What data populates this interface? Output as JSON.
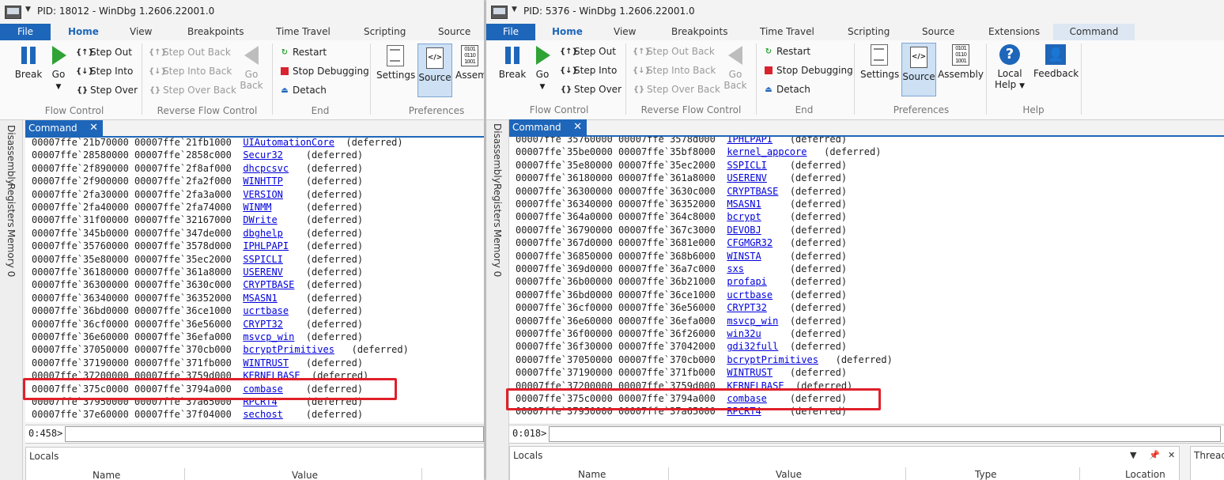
{
  "tabs": {
    "file": "File",
    "home": "Home",
    "view": "View",
    "breakpoints": "Breakpoints",
    "time_travel": "Time Travel",
    "scripting": "Scripting",
    "source": "Source",
    "extensions": "Extensions",
    "command": "Command"
  },
  "ribbon": {
    "break": "Break",
    "go": "Go",
    "step_out": "Step Out",
    "step_into": "Step Into",
    "step_over": "Step Over",
    "step_out_back": "Step Out Back",
    "step_into_back": "Step Into Back",
    "step_over_back": "Step Over Back",
    "go_back_line1": "Go",
    "go_back_line2": "Back",
    "restart": "Restart",
    "stop_debugging": "Stop Debugging",
    "detach": "Detach",
    "settings": "Settings",
    "source": "Source",
    "assembly": "Assembly",
    "assembly_cut": "Assemb",
    "local_help_line1": "Local",
    "local_help_line2": "Help",
    "feedback": "Feedback",
    "groups": {
      "flow_control": "Flow Control",
      "reverse_flow_control": "Reverse Flow Control",
      "end": "End",
      "preferences": "Preferences",
      "help": "Help"
    }
  },
  "sidebar": {
    "disassembly": "Disassembly",
    "registers": "Registers",
    "memory": "Memory 0"
  },
  "panel": {
    "command_tab": "Command",
    "close_glyph": "✕"
  },
  "locals": {
    "title": "Locals",
    "threads_title": "Thread",
    "columns": {
      "name": "Name",
      "value": "Value",
      "type": "Type",
      "location": "Location"
    }
  },
  "windows": [
    {
      "title": "PID: 18012 - WinDbg 1.2606.22001.0",
      "prompt": "0:458>",
      "lines": [
        {
          "addr": "00007ffe`21b70000 00007ffe`21fb1000",
          "mod": "UIAutomationCore",
          "pad": "  ",
          "status": "(deferred)"
        },
        {
          "addr": "00007ffe`28580000 00007ffe`2858c000",
          "mod": "Secur32",
          "pad": "    ",
          "status": "(deferred)"
        },
        {
          "addr": "00007ffe`2f890000 00007ffe`2f8af000",
          "mod": "dhcpcsvc",
          "pad": "   ",
          "status": "(deferred)"
        },
        {
          "addr": "00007ffe`2f900000 00007ffe`2fa2f000",
          "mod": "WINHTTP",
          "pad": "    ",
          "status": "(deferred)"
        },
        {
          "addr": "00007ffe`2fa30000 00007ffe`2fa3a000",
          "mod": "VERSION",
          "pad": "    ",
          "status": "(deferred)"
        },
        {
          "addr": "00007ffe`2fa40000 00007ffe`2fa74000",
          "mod": "WINMM",
          "pad": "      ",
          "status": "(deferred)"
        },
        {
          "addr": "00007ffe`31f00000 00007ffe`32167000",
          "mod": "DWrite",
          "pad": "     ",
          "status": "(deferred)"
        },
        {
          "addr": "00007ffe`345b0000 00007ffe`347de000",
          "mod": "dbghelp",
          "pad": "    ",
          "status": "(deferred)"
        },
        {
          "addr": "00007ffe`35760000 00007ffe`3578d000",
          "mod": "IPHLPAPI",
          "pad": "   ",
          "status": "(deferred)"
        },
        {
          "addr": "00007ffe`35e80000 00007ffe`35ec2000",
          "mod": "SSPICLI",
          "pad": "    ",
          "status": "(deferred)"
        },
        {
          "addr": "00007ffe`36180000 00007ffe`361a8000",
          "mod": "USERENV",
          "pad": "    ",
          "status": "(deferred)"
        },
        {
          "addr": "00007ffe`36300000 00007ffe`3630c000",
          "mod": "CRYPTBASE",
          "pad": "  ",
          "status": "(deferred)"
        },
        {
          "addr": "00007ffe`36340000 00007ffe`36352000",
          "mod": "MSASN1",
          "pad": "     ",
          "status": "(deferred)"
        },
        {
          "addr": "00007ffe`36bd0000 00007ffe`36ce1000",
          "mod": "ucrtbase",
          "pad": "   ",
          "status": "(deferred)"
        },
        {
          "addr": "00007ffe`36cf0000 00007ffe`36e56000",
          "mod": "CRYPT32",
          "pad": "    ",
          "status": "(deferred)"
        },
        {
          "addr": "00007ffe`36e60000 00007ffe`36efa000",
          "mod": "msvcp_win",
          "pad": "  ",
          "status": "(deferred)"
        },
        {
          "addr": "00007ffe`37050000 00007ffe`370cb000",
          "mod": "bcryptPrimitives",
          "pad": "   ",
          "status": "(deferred)"
        },
        {
          "addr": "00007ffe`37190000 00007ffe`371fb000",
          "mod": "WINTRUST",
          "pad": "   ",
          "status": "(deferred)"
        },
        {
          "addr": "00007ffe`37200000 00007ffe`3759d000",
          "mod": "KERNELBASE",
          "pad": "  ",
          "status": "(deferred)"
        },
        {
          "addr": "00007ffe`375c0000 00007ffe`3794a000",
          "mod": "combase",
          "pad": "    ",
          "status": "(deferred)"
        },
        {
          "addr": "00007ffe`37950000 00007ffe`37a65000",
          "mod": "RPCRT4",
          "pad": "     ",
          "status": "(deferred)"
        },
        {
          "addr": "00007ffe`37e60000 00007ffe`37f04000",
          "mod": "sechost",
          "pad": "    ",
          "status": "(deferred)"
        }
      ]
    },
    {
      "title": "PID: 5376 - WinDbg 1.2606.22001.0",
      "prompt": "0:018>",
      "lines": [
        {
          "addr": "00007ffe`35760000 00007ffe`3578d000",
          "mod": "IPHLPAPI",
          "pad": "   ",
          "status": "(deferred)"
        },
        {
          "addr": "00007ffe`35be0000 00007ffe`35bf8000",
          "mod": "kernel_appcore",
          "pad": "   ",
          "status": "(deferred)"
        },
        {
          "addr": "00007ffe`35e80000 00007ffe`35ec2000",
          "mod": "SSPICLI",
          "pad": "    ",
          "status": "(deferred)"
        },
        {
          "addr": "00007ffe`36180000 00007ffe`361a8000",
          "mod": "USERENV",
          "pad": "    ",
          "status": "(deferred)"
        },
        {
          "addr": "00007ffe`36300000 00007ffe`3630c000",
          "mod": "CRYPTBASE",
          "pad": "  ",
          "status": "(deferred)"
        },
        {
          "addr": "00007ffe`36340000 00007ffe`36352000",
          "mod": "MSASN1",
          "pad": "     ",
          "status": "(deferred)"
        },
        {
          "addr": "00007ffe`364a0000 00007ffe`364c8000",
          "mod": "bcrypt",
          "pad": "     ",
          "status": "(deferred)"
        },
        {
          "addr": "00007ffe`36790000 00007ffe`367c3000",
          "mod": "DEVOBJ",
          "pad": "     ",
          "status": "(deferred)"
        },
        {
          "addr": "00007ffe`367d0000 00007ffe`3681e000",
          "mod": "CFGMGR32",
          "pad": "   ",
          "status": "(deferred)"
        },
        {
          "addr": "00007ffe`36850000 00007ffe`368b6000",
          "mod": "WINSTA",
          "pad": "     ",
          "status": "(deferred)"
        },
        {
          "addr": "00007ffe`369d0000 00007ffe`36a7c000",
          "mod": "sxs",
          "pad": "        ",
          "status": "(deferred)"
        },
        {
          "addr": "00007ffe`36b00000 00007ffe`36b21000",
          "mod": "profapi",
          "pad": "    ",
          "status": "(deferred)"
        },
        {
          "addr": "00007ffe`36bd0000 00007ffe`36ce1000",
          "mod": "ucrtbase",
          "pad": "   ",
          "status": "(deferred)"
        },
        {
          "addr": "00007ffe`36cf0000 00007ffe`36e56000",
          "mod": "CRYPT32",
          "pad": "    ",
          "status": "(deferred)"
        },
        {
          "addr": "00007ffe`36e60000 00007ffe`36efa000",
          "mod": "msvcp_win",
          "pad": "  ",
          "status": "(deferred)"
        },
        {
          "addr": "00007ffe`36f00000 00007ffe`36f26000",
          "mod": "win32u",
          "pad": "     ",
          "status": "(deferred)"
        },
        {
          "addr": "00007ffe`36f30000 00007ffe`37042000",
          "mod": "gdi32full",
          "pad": "  ",
          "status": "(deferred)"
        },
        {
          "addr": "00007ffe`37050000 00007ffe`370cb000",
          "mod": "bcryptPrimitives",
          "pad": "   ",
          "status": "(deferred)"
        },
        {
          "addr": "00007ffe`37190000 00007ffe`371fb000",
          "mod": "WINTRUST",
          "pad": "   ",
          "status": "(deferred)"
        },
        {
          "addr": "00007ffe`37200000 00007ffe`3759d000",
          "mod": "KERNELBASE",
          "pad": "  ",
          "status": "(deferred)"
        },
        {
          "addr": "00007ffe`375c0000 00007ffe`3794a000",
          "mod": "combase",
          "pad": "    ",
          "status": "(deferred)"
        },
        {
          "addr": "00007ffe`37950000 00007ffe`37a65000",
          "mod": "RPCRT4",
          "pad": "     ",
          "status": "(deferred)"
        }
      ]
    }
  ]
}
